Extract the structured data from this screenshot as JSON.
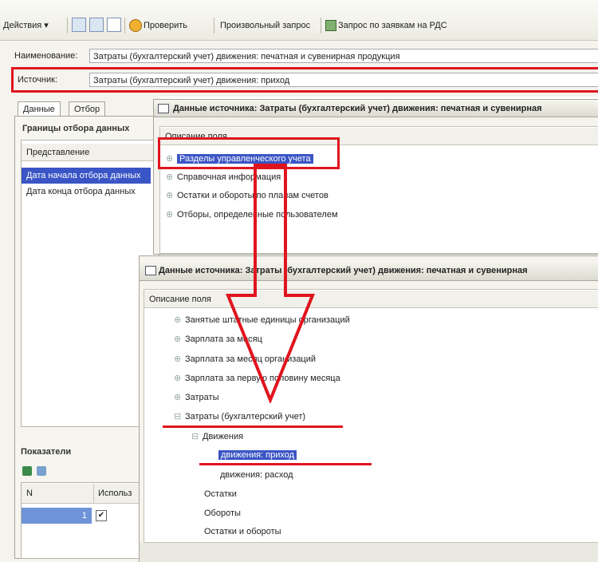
{
  "toolbar": {
    "actions_label": "Действия ▾",
    "check_label": "Проверить",
    "custom_query_label": "Произвольный запрос",
    "request_label": "Запрос по заявкам на РДС"
  },
  "form": {
    "name_label": "Наименование:",
    "name_value": "Затраты (бухгалтерский учет) движения: печатная и сувенирная продукция",
    "source_label": "Источник:",
    "source_value": "Затраты (бухгалтерский учет) движения: приход"
  },
  "left_panel": {
    "tabs": [
      "Данные",
      "Отбор"
    ],
    "section_title": "Границы отбора данных",
    "column_header": "Представление",
    "items": [
      "Дата начала отбора данных",
      "Дата конца отбора данных"
    ],
    "indicators_title": "Показатели",
    "indicators_columns": [
      "N",
      "Использ"
    ],
    "indicators_row_number": "1",
    "indicators_row_check": "✔"
  },
  "window1": {
    "title": "Данные источника: Затраты (бухгалтерский учет) движения: печатная и сувенирная",
    "fields_header": "Описание поля",
    "items": [
      {
        "label": "Разделы управленческого учета",
        "selected": true
      },
      {
        "label": "Справочная информация",
        "selected": false
      },
      {
        "label": "Остатки и обороты по планам счетов",
        "selected": false
      },
      {
        "label": "Отборы, определенные пользователем",
        "selected": false
      }
    ]
  },
  "window2": {
    "title": "Данные источника: Затраты (бухгалтерский учет) движения: печатная и сувенирная",
    "fields_header": "Описание поля",
    "items": [
      {
        "label": "Занятые штатные единицы организаций",
        "marker": "+"
      },
      {
        "label": "Зарплата за месяц",
        "marker": "+"
      },
      {
        "label": "Зарплата за месяц организаций",
        "marker": "+"
      },
      {
        "label": "Зарплата за первую половину месяца",
        "marker": "+"
      },
      {
        "label": "Затраты",
        "marker": "+"
      },
      {
        "label": "Затраты (бухгалтерский учет)",
        "marker": "−"
      },
      {
        "label": "Движения",
        "marker": "−"
      },
      {
        "label": "движения: приход",
        "marker": ""
      },
      {
        "label": "движения: расход",
        "marker": ""
      },
      {
        "label": "Остатки",
        "marker": ""
      },
      {
        "label": "Обороты",
        "marker": ""
      },
      {
        "label": "Остатки и обороты",
        "marker": ""
      }
    ]
  },
  "colors": {
    "highlight_red": "#e0141e",
    "selection_blue": "#3a55c5"
  }
}
